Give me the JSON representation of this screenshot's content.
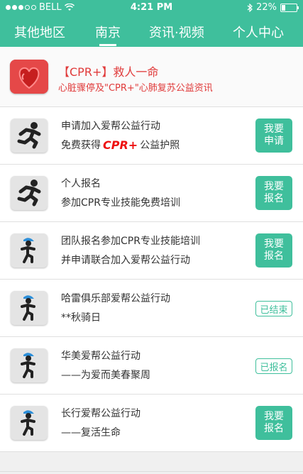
{
  "status_bar": {
    "carrier": "BELL",
    "time": "4:21 PM",
    "battery": "22%"
  },
  "tabs": [
    {
      "label": "其他地区"
    },
    {
      "label": "南京"
    },
    {
      "label": "资讯·视频"
    },
    {
      "label": "个人中心"
    }
  ],
  "banner": {
    "title": "【CPR+】救人一命",
    "subtitle": "心脏骤停及\"CPR+\"心肺复苏公益资讯"
  },
  "items": [
    {
      "line1": "申请加入爱帮公益行动",
      "line2_pre": "免费获得",
      "line2_logo": "CPR+",
      "line2_post": "公益护照",
      "action": "我要\n申请",
      "icon": "runner-icon"
    },
    {
      "line1": "个人报名",
      "line2": "参加CPR专业技能免费培训",
      "action": "我要\n报名",
      "icon": "runner-icon"
    },
    {
      "line1": "团队报名参加CPR专业技能培训",
      "line2": "并申请联合加入爱帮公益行动",
      "action": "我要\n报名",
      "icon": "cyclist-icon"
    },
    {
      "line1": "哈雷俱乐部爱帮公益行动",
      "line2": "**秋骑日",
      "status": "已结束",
      "icon": "cyclist-icon"
    },
    {
      "line1": "华美爱帮公益行动",
      "line2": "——为爱而美春聚周",
      "status": "已报名",
      "icon": "cyclist-icon"
    },
    {
      "line1": "长行爱帮公益行动",
      "line2": "——复活生命",
      "action": "我要\n报名",
      "icon": "cyclist-icon"
    }
  ],
  "colors": {
    "accent": "#3fbf9c",
    "brand_red": "#e03a3a"
  }
}
